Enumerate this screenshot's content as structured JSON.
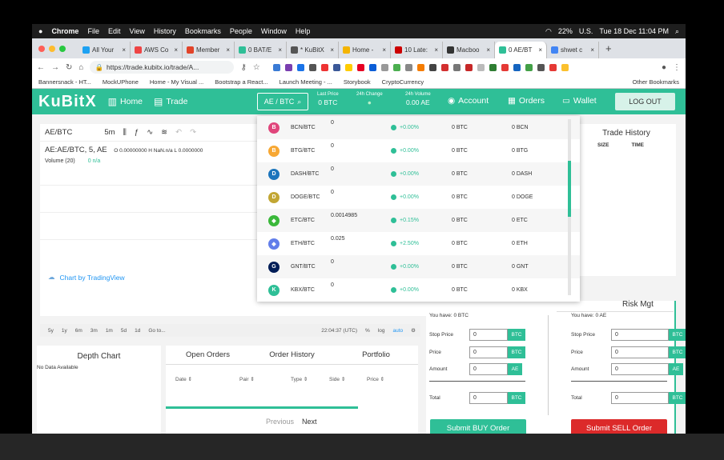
{
  "menubar": {
    "apple": "",
    "app": "Chrome",
    "items": [
      "File",
      "Edit",
      "View",
      "History",
      "Bookmarks",
      "People",
      "Window",
      "Help"
    ],
    "battery": "22%",
    "locale": "U.S.",
    "clock": "Tue 18 Dec  11:04 PM"
  },
  "tabs": [
    {
      "label": "All Your",
      "color": "#1da1f2"
    },
    {
      "label": "AWS Co",
      "color": "#e44"
    },
    {
      "label": "Member",
      "color": "#e24329"
    },
    {
      "label": "0 BAT/E",
      "color": "#2fbf97"
    },
    {
      "label": "* KuBitX",
      "color": "#555"
    },
    {
      "label": "Home -",
      "color": "#f4b400"
    },
    {
      "label": "10 Late:",
      "color": "#c00"
    },
    {
      "label": "Macboo",
      "color": "#333"
    },
    {
      "label": "0 AE/BT",
      "color": "#2fbf97"
    },
    {
      "label": "shwet c",
      "color": "#4285f4"
    }
  ],
  "url": "https://trade.kubitx.io/trade/A...",
  "bookmarks": [
    "Bannersnack - HT...",
    "MockUPhone",
    "Home - My Visual ...",
    "Bootstrap a React...",
    "Launch Meeting - ...",
    "Storybook",
    "CryptoCurrency"
  ],
  "bookmarks_other": "Other Bookmarks",
  "nav": {
    "logo": "KuBitX",
    "home": "Home",
    "trade": "Trade",
    "pair": "AE / BTC",
    "last_price_label": "Last Price",
    "last_price": "0 BTC",
    "change_label": "24h Change",
    "volume_label": "24h Volume",
    "volume": "0.00 AE",
    "account": "Account",
    "orders": "Orders",
    "wallet": "Wallet",
    "logout": "LOG OUT"
  },
  "chart": {
    "symbol": "AE/BTC",
    "interval": "5m",
    "legend": "AE:AE/BTC, 5, AE",
    "ohlc": "O 0.00000000  H NaN.n/a  L 0.0000000",
    "volume": "Volume (20)",
    "volume_val": "0  n/a",
    "credit": "Chart by TradingView",
    "ranges": [
      "5y",
      "1y",
      "6m",
      "3m",
      "1m",
      "5d",
      "1d",
      "Go to..."
    ],
    "time": "22:04:37 (UTC)",
    "pct": "%",
    "log": "log",
    "auto": "auto"
  },
  "dropdown": [
    {
      "pair": "BCN/BTC",
      "price": "0",
      "change": "+0.00%",
      "v1": "0 BTC",
      "v2": "0 BCN",
      "color": "#e0457b",
      "glyph": "B"
    },
    {
      "pair": "BTG/BTC",
      "price": "0",
      "change": "+0.00%",
      "v1": "0 BTC",
      "v2": "0 BTG",
      "color": "#f7a733",
      "glyph": "B"
    },
    {
      "pair": "DASH/BTC",
      "price": "0",
      "change": "+0.00%",
      "v1": "0 BTC",
      "v2": "0 DASH",
      "color": "#1c75bc",
      "glyph": "D"
    },
    {
      "pair": "DOGE/BTC",
      "price": "0",
      "change": "+0.00%",
      "v1": "0 BTC",
      "v2": "0 DOGE",
      "color": "#c2a633",
      "glyph": "D"
    },
    {
      "pair": "ETC/BTC",
      "price": "0.0014985",
      "change": "+0.15%",
      "v1": "0 BTC",
      "v2": "0 ETC",
      "color": "#3ab83a",
      "glyph": "◆"
    },
    {
      "pair": "ETH/BTC",
      "price": "0.025",
      "change": "+2.50%",
      "v1": "0 BTC",
      "v2": "0 ETH",
      "color": "#627eea",
      "glyph": "◆"
    },
    {
      "pair": "GNT/BTC",
      "price": "0",
      "change": "+0.00%",
      "v1": "0 BTC",
      "v2": "0 GNT",
      "color": "#001d57",
      "glyph": "G"
    },
    {
      "pair": "KBX/BTC",
      "price": "0",
      "change": "+0.00%",
      "v1": "0 BTC",
      "v2": "0 KBX",
      "color": "#2fbf97",
      "glyph": "K"
    }
  ],
  "trade_history": {
    "title": "Trade History",
    "size": "SIZE",
    "time": "TIME"
  },
  "depth": {
    "title": "Depth Chart",
    "empty": "No Data Available"
  },
  "orders": {
    "tabs": [
      "Open Orders",
      "Order History",
      "Portfolio"
    ],
    "cols": [
      "Date",
      "Pair",
      "Type",
      "Side",
      "Price"
    ],
    "prev": "Previous",
    "next": "Next"
  },
  "buy": {
    "have": "You have: 0 BTC",
    "stop": "Stop Price",
    "price": "Price",
    "amount": "Amount",
    "total": "Total",
    "stop_val": "0",
    "price_val": "0",
    "amount_val": "0",
    "total_val": "0",
    "stop_unit": "BTC",
    "price_unit": "BTC",
    "amount_unit": "AE",
    "total_unit": "BTC",
    "button": "Submit BUY Order"
  },
  "sell": {
    "risk": "Risk Mgt",
    "have": "You have: 0 AE",
    "stop": "Stop Price",
    "price": "Price",
    "amount": "Amount",
    "total": "Total",
    "stop_val": "0",
    "price_val": "0",
    "amount_val": "0",
    "total_val": "0",
    "stop_unit": "BTC",
    "price_unit": "BTC",
    "amount_unit": "AE",
    "total_unit": "BTC",
    "button": "Submit SELL Order"
  },
  "colors": {
    "brand": "#2fbf97",
    "sell": "#dc2a2a"
  }
}
